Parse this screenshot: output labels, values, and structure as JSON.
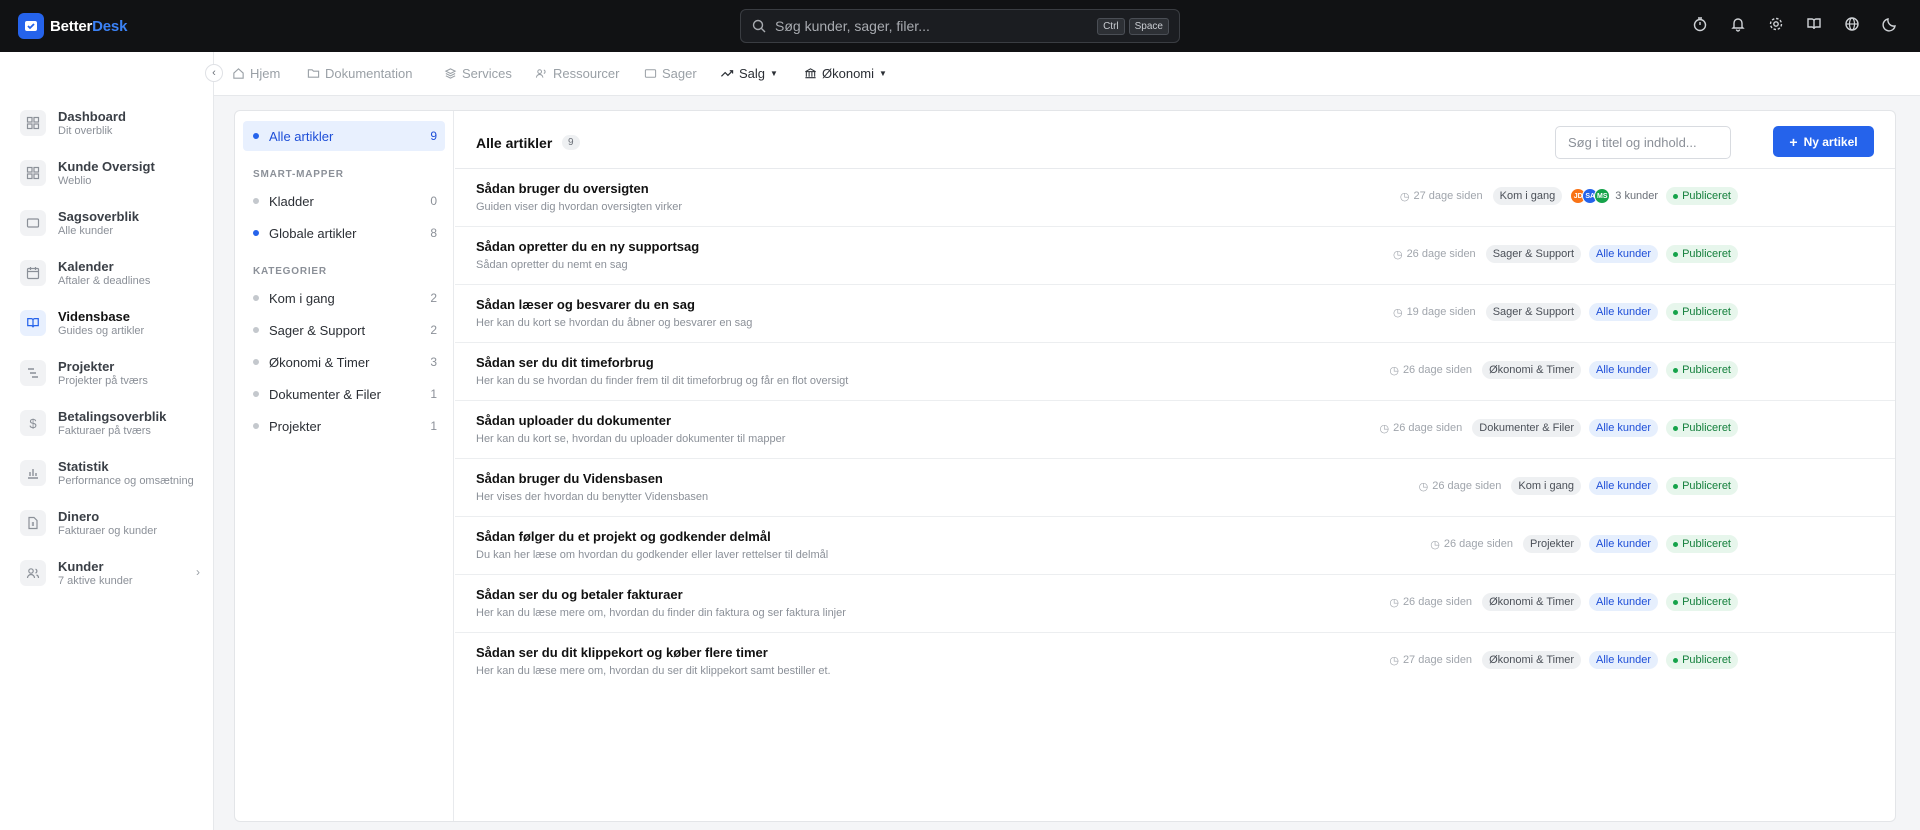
{
  "app": {
    "logo_a": "Better",
    "logo_b": "Desk"
  },
  "search": {
    "placeholder": "Søg kunder, sager, filer...",
    "kbd1": "Ctrl",
    "kbd2": "Space"
  },
  "topicons": [
    "timer-icon",
    "bell-icon",
    "gear-icon",
    "book-icon",
    "globe-icon",
    "moon-icon"
  ],
  "sidebar": {
    "items": [
      {
        "title": "Dashboard",
        "sub": "Dit overblik",
        "icon": "grid-icon"
      },
      {
        "title": "Kunde Oversigt",
        "sub": "Weblio",
        "icon": "grid-icon"
      },
      {
        "title": "Sagsoverblik",
        "sub": "Alle kunder",
        "icon": "ticket-icon"
      },
      {
        "title": "Kalender",
        "sub": "Aftaler & deadlines",
        "icon": "calendar-icon"
      },
      {
        "title": "Vidensbase",
        "sub": "Guides og artikler",
        "icon": "book-icon"
      },
      {
        "title": "Projekter",
        "sub": "Projekter på tværs",
        "icon": "gantt-icon"
      },
      {
        "title": "Betalingsoverblik",
        "sub": "Fakturaer på tværs",
        "icon": "dollar-icon"
      },
      {
        "title": "Statistik",
        "sub": "Performance og omsætning",
        "icon": "chart-icon"
      },
      {
        "title": "Dinero",
        "sub": "Fakturaer og kunder",
        "icon": "file-dollar-icon"
      },
      {
        "title": "Kunder",
        "sub": "7 aktive kunder",
        "icon": "users-icon"
      }
    ]
  },
  "breadcrumbs": [
    "Hjem",
    "Dokumentation",
    "Services",
    "Ressourcer",
    "Sager",
    "Salg",
    "Økonomi"
  ],
  "folders": {
    "all": {
      "label": "Alle artikler",
      "count": "9"
    },
    "smart_title": "SMART-MAPPER",
    "smart": [
      {
        "label": "Kladder",
        "count": "0"
      },
      {
        "label": "Globale artikler",
        "count": "8"
      }
    ],
    "cat_title": "KATEGORIER",
    "cats": [
      {
        "label": "Kom i gang",
        "count": "2"
      },
      {
        "label": "Sager & Support",
        "count": "2"
      },
      {
        "label": "Økonomi & Timer",
        "count": "3"
      },
      {
        "label": "Dokumenter & Filer",
        "count": "1"
      },
      {
        "label": "Projekter",
        "count": "1"
      }
    ]
  },
  "list": {
    "title": "Alle artikler",
    "count": "9",
    "search_placeholder": "Søg i titel og indhold...",
    "new_label": "Ny artikel"
  },
  "articles": [
    {
      "title": "Sådan bruger du oversigten",
      "desc": "Guiden viser dig hvordan oversigten virker",
      "time": "27 dage siden",
      "tag": "Kom i gang",
      "customers": "3 kunder",
      "avatars": [
        "JD",
        "SA",
        "MS"
      ],
      "status": "Publiceret"
    },
    {
      "title": "Sådan opretter du en ny supportsag",
      "desc": "Sådan opretter du nemt en sag",
      "time": "26 dage siden",
      "tag": "Sager & Support",
      "customers": "Alle kunder",
      "status": "Publiceret"
    },
    {
      "title": "Sådan læser og besvarer du en sag",
      "desc": "Her kan du kort se hvordan du åbner og besvarer en sag",
      "time": "19 dage siden",
      "tag": "Sager & Support",
      "customers": "Alle kunder",
      "status": "Publiceret"
    },
    {
      "title": "Sådan ser du dit timeforbrug",
      "desc": "Her kan du se hvordan du finder frem til dit timeforbrug og får en flot oversigt",
      "time": "26 dage siden",
      "tag": "Økonomi & Timer",
      "customers": "Alle kunder",
      "status": "Publiceret"
    },
    {
      "title": "Sådan uploader du dokumenter",
      "desc": "Her kan du kort se, hvordan du uploader dokumenter til mapper",
      "time": "26 dage siden",
      "tag": "Dokumenter & Filer",
      "customers": "Alle kunder",
      "status": "Publiceret"
    },
    {
      "title": "Sådan bruger du Vidensbasen",
      "desc": "Her vises der hvordan du benytter Vidensbasen",
      "time": "26 dage siden",
      "tag": "Kom i gang",
      "customers": "Alle kunder",
      "status": "Publiceret"
    },
    {
      "title": "Sådan følger du et projekt og godkender delmål",
      "desc": "Du kan her læse om hvordan du godkender eller laver rettelser til delmål",
      "time": "26 dage siden",
      "tag": "Projekter",
      "customers": "Alle kunder",
      "status": "Publiceret"
    },
    {
      "title": "Sådan ser du og betaler fakturaer",
      "desc": "Her kan du læse mere om, hvordan du finder din faktura og ser faktura linjer",
      "time": "26 dage siden",
      "tag": "Økonomi & Timer",
      "customers": "Alle kunder",
      "status": "Publiceret"
    },
    {
      "title": "Sådan ser du dit klippekort og køber flere timer",
      "desc": "Her kan du læse mere om, hvordan du ser dit klippekort samt bestiller et.",
      "time": "27 dage siden",
      "tag": "Økonomi & Timer",
      "customers": "Alle kunder",
      "status": "Publiceret"
    }
  ],
  "colors": {
    "accent": "#2563eb",
    "topbar": "#111214",
    "published": "#15803d",
    "avatar1": "#f97316",
    "avatar2": "#2563eb",
    "avatar3": "#16a34a"
  }
}
